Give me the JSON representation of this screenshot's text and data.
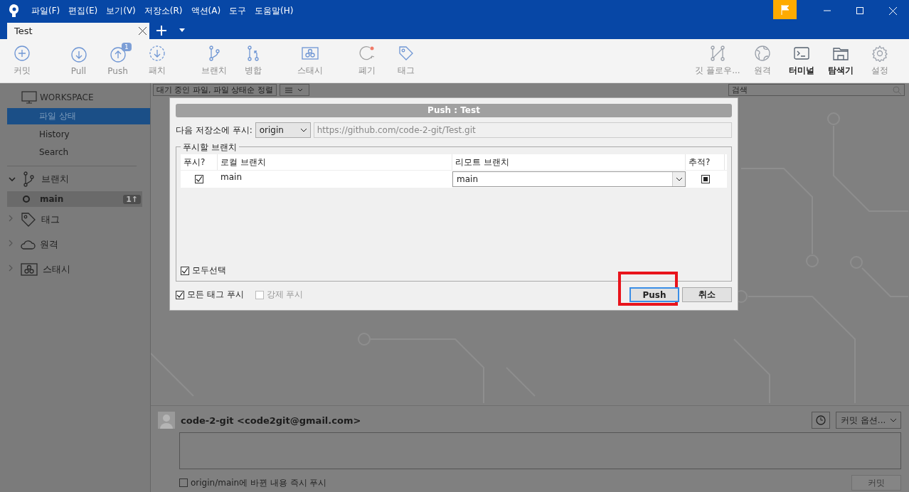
{
  "menu": [
    "파일(F)",
    "편집(E)",
    "보기(V)",
    "저장소(R)",
    "액션(A)",
    "도구",
    "도움말(H)"
  ],
  "tabs": [
    {
      "label": "Test",
      "selected": true
    }
  ],
  "toolbar_left": [
    {
      "label": "커밋",
      "active": false
    },
    {
      "label": "Pull",
      "active": false
    },
    {
      "label": "Push",
      "active": false,
      "badge": "1"
    },
    {
      "label": "패치",
      "active": false
    },
    {
      "label": "브랜치",
      "active": false
    },
    {
      "label": "병합",
      "active": false
    },
    {
      "label": "스태시",
      "active": false
    },
    {
      "label": "폐기",
      "active": false
    },
    {
      "label": "태그",
      "active": false
    }
  ],
  "toolbar_right": [
    {
      "label": "깃 플로우...",
      "active": false
    },
    {
      "label": "원격",
      "active": false
    },
    {
      "label": "터미널",
      "active": true
    },
    {
      "label": "탐색기",
      "active": true
    },
    {
      "label": "설정",
      "active": false
    }
  ],
  "sidebar": {
    "header": "WORKSPACE",
    "items": [
      {
        "label": "파일 상태",
        "selected": true
      },
      {
        "label": "History",
        "selected": false
      },
      {
        "label": "Search",
        "selected": false
      }
    ],
    "sections": [
      {
        "label": "브랜치",
        "expanded": true,
        "children": [
          {
            "label": "main",
            "badge": "1↑"
          }
        ]
      },
      {
        "label": "태그",
        "expanded": false
      },
      {
        "label": "원격",
        "expanded": false
      },
      {
        "label": "스태시",
        "expanded": false
      }
    ]
  },
  "file_bar": {
    "filter": "대기 중인 파일, 파일 상태순 정렬",
    "search": {
      "placeholder": "검색"
    }
  },
  "dialog": {
    "title": "Push :  Test",
    "repo_label": "다음 저장소에 푸시:",
    "remote": "origin",
    "url": "https://github.com/code-2-git/Test.git",
    "group": "푸시할 브랜치",
    "columns": [
      "푸시?",
      "로컬 브랜치",
      "리모트 브랜치",
      "추적?"
    ],
    "rows": [
      {
        "push": true,
        "local": "main",
        "remote": "main",
        "track": true
      }
    ],
    "select_all": {
      "label": "모두선택",
      "checked": true
    },
    "options": [
      {
        "label": "모든 태그 푸시",
        "checked": true,
        "disabled": false
      },
      {
        "label": "강제 푸시",
        "checked": false,
        "disabled": true
      }
    ],
    "buttons": [
      {
        "label": "Push",
        "kind": "primary",
        "highlighted": true
      },
      {
        "label": "취소",
        "kind": "secondary",
        "highlighted": false
      }
    ]
  },
  "commit": {
    "author": "code-2-git <code2git@gmail.com>",
    "options": "커밋 옵션...",
    "push_now": {
      "label": "origin/main에 바뀐 내용 즉시 푸시",
      "checked": false
    },
    "button": "커밋"
  }
}
